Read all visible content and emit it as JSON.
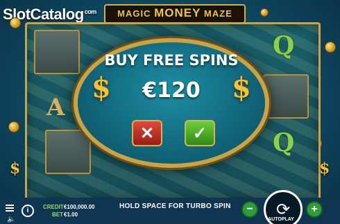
{
  "brand": {
    "name": "SlotCatalog",
    "suffix": "com"
  },
  "game": {
    "title_left": "MAGIC",
    "title_big": "MONEY",
    "title_right": "MAZE"
  },
  "dialog": {
    "title": "BUY FREE SPINS",
    "price": "€120",
    "left_symbol": "$",
    "right_symbol": "$",
    "cancel_glyph": "✕",
    "confirm_glyph": "✓"
  },
  "reels": {
    "symbols": [
      "Q",
      "A",
      "Q"
    ],
    "side_symbol": "$"
  },
  "bottom_bar": {
    "credit_label": "CREDIT",
    "credit_value": "€100,000.00",
    "bet_label": "BET",
    "bet_value": "€1.00",
    "hint": "HOLD SPACE FOR TURBO SPIN",
    "autoplay_label": "AUTOPLAY",
    "minus_glyph": "−",
    "plus_glyph": "+",
    "info_glyph": "i",
    "spin_glyph": "⟳",
    "speaker_glyph": "🔈"
  },
  "colors": {
    "gold": "#c9a347",
    "dollar": "#f2c23b",
    "cancel": "#e04a3b",
    "confirm": "#6ccf3a",
    "credit_label": "#8fe06a"
  }
}
